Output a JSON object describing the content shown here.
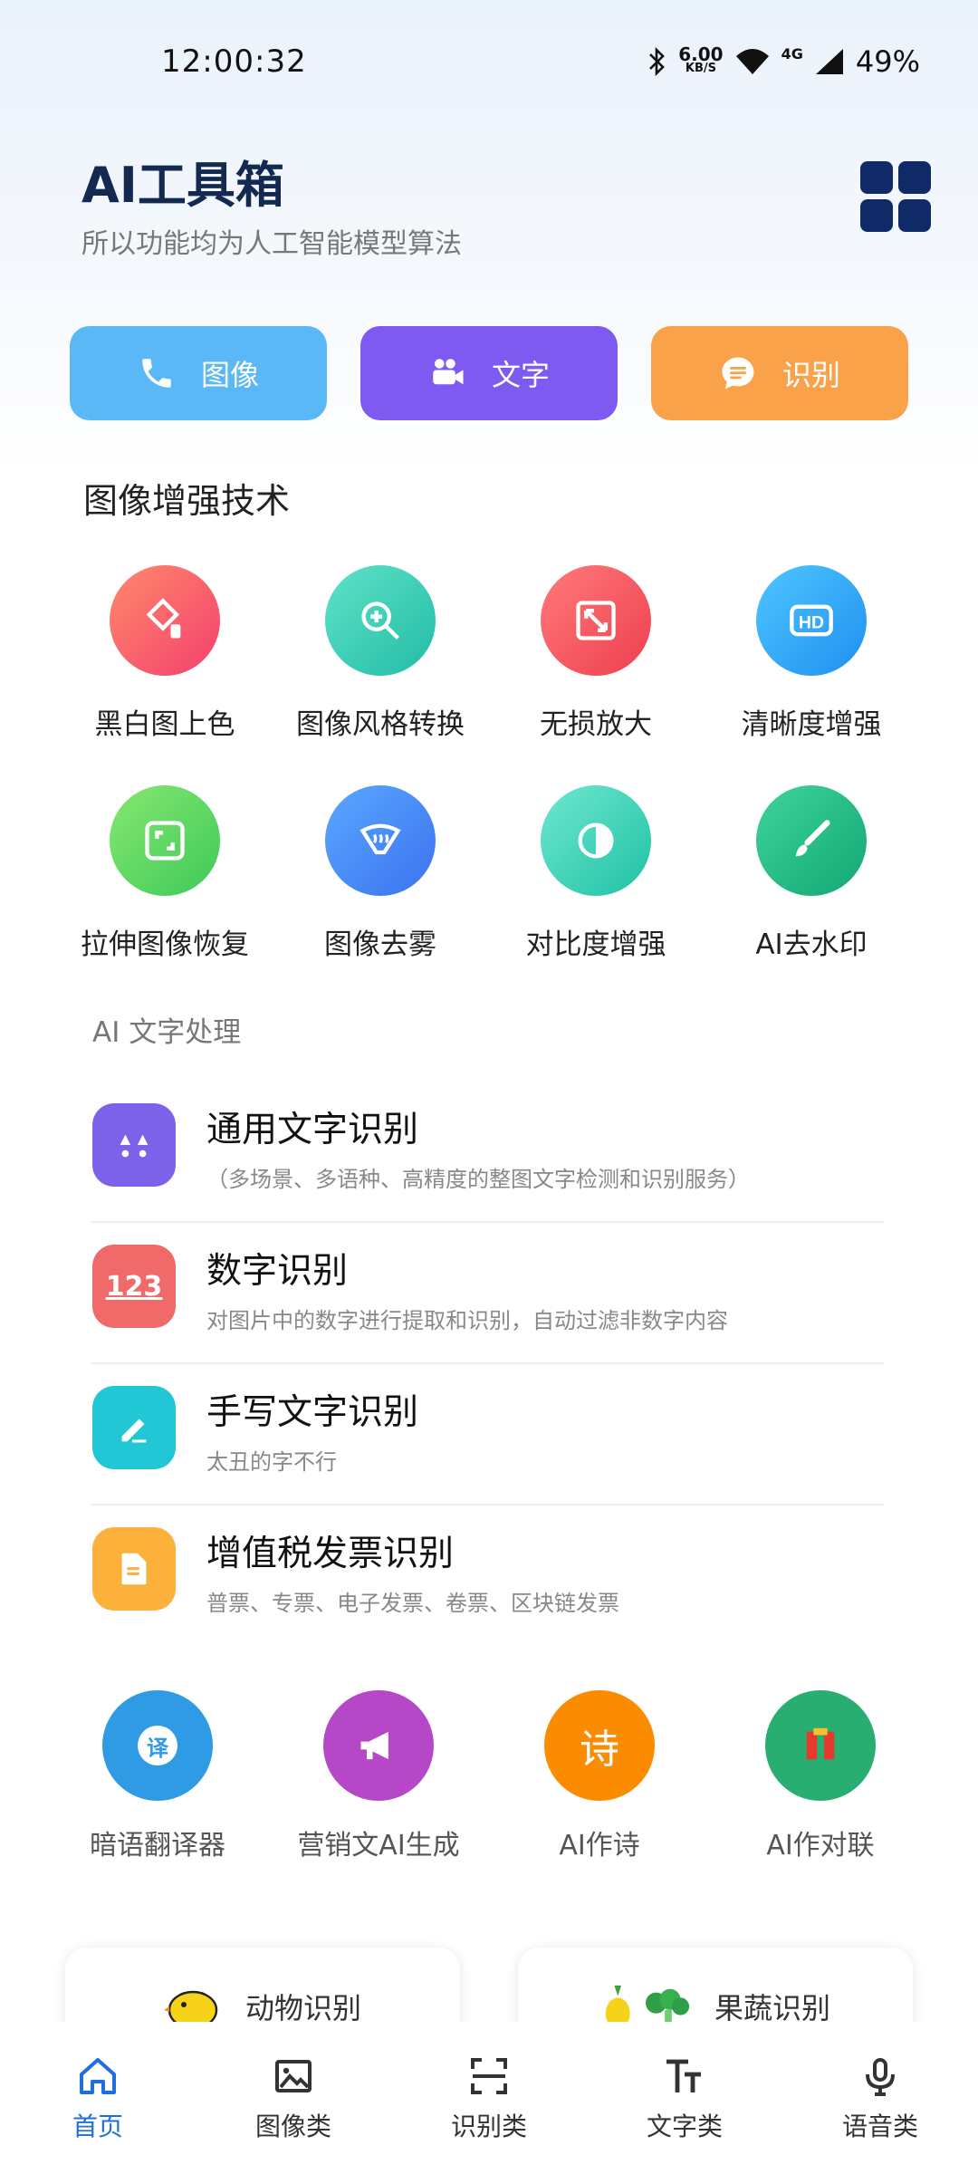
{
  "status_bar": {
    "time": "12:00:32",
    "net_speed": "6.00",
    "net_unit": "KB/S",
    "network": "4G",
    "battery": "49%"
  },
  "header": {
    "title": "AI工具箱",
    "subtitle": "所以功能均为人工智能模型算法",
    "menu_icon": "grid-icon"
  },
  "quick_buttons": [
    {
      "label": "图像",
      "icon": "phone-icon",
      "color": "#5ab8f6"
    },
    {
      "label": "文字",
      "icon": "video-camera-icon",
      "color": "#7f5af0"
    },
    {
      "label": "识别",
      "icon": "message-icon",
      "color": "#f9a24a"
    }
  ],
  "section1": {
    "title": "图像增强技术",
    "items": [
      {
        "label": "黑白图上色",
        "icon": "paint-bucket-icon"
      },
      {
        "label": "图像风格转换",
        "icon": "zoom-in-icon"
      },
      {
        "label": "无损放大",
        "icon": "expand-icon"
      },
      {
        "label": "清晰度增强",
        "icon": "hd-icon"
      },
      {
        "label": "拉伸图像恢复",
        "icon": "frame-icon"
      },
      {
        "label": "图像去雾",
        "icon": "haze-icon"
      },
      {
        "label": "对比度增强",
        "icon": "contrast-icon"
      },
      {
        "label": "AI去水印",
        "icon": "brush-icon"
      }
    ]
  },
  "section2": {
    "title": "AI 文字处理",
    "items": [
      {
        "title": "通用文字识别",
        "desc": "（多场景、多语种、高精度的整图文字检测和识别服务）",
        "icon": "text-scan-icon",
        "color": "#7b62e8"
      },
      {
        "title": "数字识别",
        "desc": "对图片中的数字进行提取和识别，自动过滤非数字内容",
        "icon": "123-icon",
        "color": "#f06a6a"
      },
      {
        "title": "手写文字识别",
        "desc": "太丑的字不行",
        "icon": "pencil-icon",
        "color": "#22c7d6"
      },
      {
        "title": "增值税发票识别",
        "desc": "普票、专票、电子发票、卷票、区块链发票",
        "icon": "document-icon",
        "color": "#fbb13c"
      }
    ]
  },
  "tools": [
    {
      "label": "暗语翻译器",
      "icon": "translate-icon",
      "glyph": "译",
      "color": "#2e9be4"
    },
    {
      "label": "营销文AI生成",
      "icon": "megaphone-icon",
      "color": "#b548c6"
    },
    {
      "label": "AI作诗",
      "icon": "poem-icon",
      "glyph": "诗",
      "color": "#fb8c00"
    },
    {
      "label": "AI作对联",
      "icon": "couplet-icon",
      "color": "#27ae70"
    }
  ],
  "cards": [
    {
      "label": "动物识别",
      "icon": "chick-icon"
    },
    {
      "label": "果蔬识别",
      "icon": "pineapple-broccoli-icon"
    }
  ],
  "bottom_nav": [
    {
      "label": "首页",
      "icon": "home-icon",
      "active": true
    },
    {
      "label": "图像类",
      "icon": "image-icon",
      "active": false
    },
    {
      "label": "识别类",
      "icon": "scan-icon",
      "active": false
    },
    {
      "label": "文字类",
      "icon": "text-size-icon",
      "active": false
    },
    {
      "label": "语音类",
      "icon": "microphone-icon",
      "active": false
    }
  ]
}
